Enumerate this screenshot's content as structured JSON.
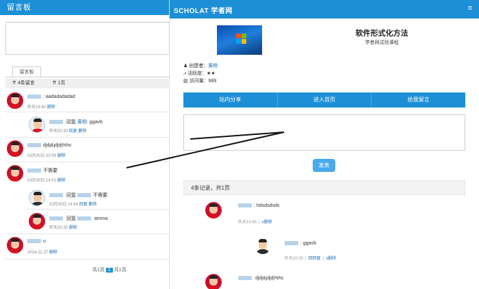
{
  "left": {
    "header": "留言板",
    "tab": "留言板",
    "stats": [
      "4条留言",
      "1页"
    ],
    "comments": [
      {
        "text": ": aadadadadad",
        "meta": "昨天19:45",
        "delete": "删除"
      },
      {
        "reply_label": "回复",
        "reply_to": "黄杨",
        "text": ": ggavb",
        "meta": "昨天20:30",
        "reply": "回复",
        "delete": "删除"
      },
      {
        "text": "djdj&jdjdj%hc",
        "meta": "03月30日 20:59",
        "delete": "删除"
      },
      {
        "text": "不需要",
        "meta": "03月30日 14:51",
        "delete": "删除"
      },
      {
        "reply_label": "回复",
        "text": "不需要",
        "meta": "03月30日 14:54",
        "reply": "回复",
        "delete": "删除"
      },
      {
        "reply_label": "回复",
        "text": "annna",
        "meta": "昨天20:30",
        "delete": "删除"
      },
      {
        "text": "u",
        "meta": "2014-11-27",
        "delete": "删除"
      }
    ],
    "pager": {
      "total": "共1页",
      "current": "1",
      "of": "共1页"
    }
  },
  "right": {
    "logo": "SCHOLAT 学者网",
    "menu_icon": "≡",
    "course_title": "软件形式化方法",
    "course_subtitle": "学者网试验课程",
    "creator_label": "创建者：",
    "creator_value": "黄杨",
    "activity_label": "活跃度：",
    "activity_value": "★★",
    "visits_label": "访问量：",
    "visits_value": "689",
    "nav": [
      "站内分享",
      "进入首页",
      "给我留言"
    ],
    "send_label": "发表",
    "records": "4条记录，共1页",
    "comments": [
      {
        "text": ": hdsdsdsds",
        "meta": "昨天19:45",
        "sep": "|",
        "delete": "x删除"
      },
      {
        "text": ": ggavb",
        "meta": "昨天20:30",
        "sep": "|",
        "reply": "回回复",
        "sep2": "|",
        "delete": "x删除"
      },
      {
        "text": "djdj&jdjdj%hc"
      }
    ]
  }
}
